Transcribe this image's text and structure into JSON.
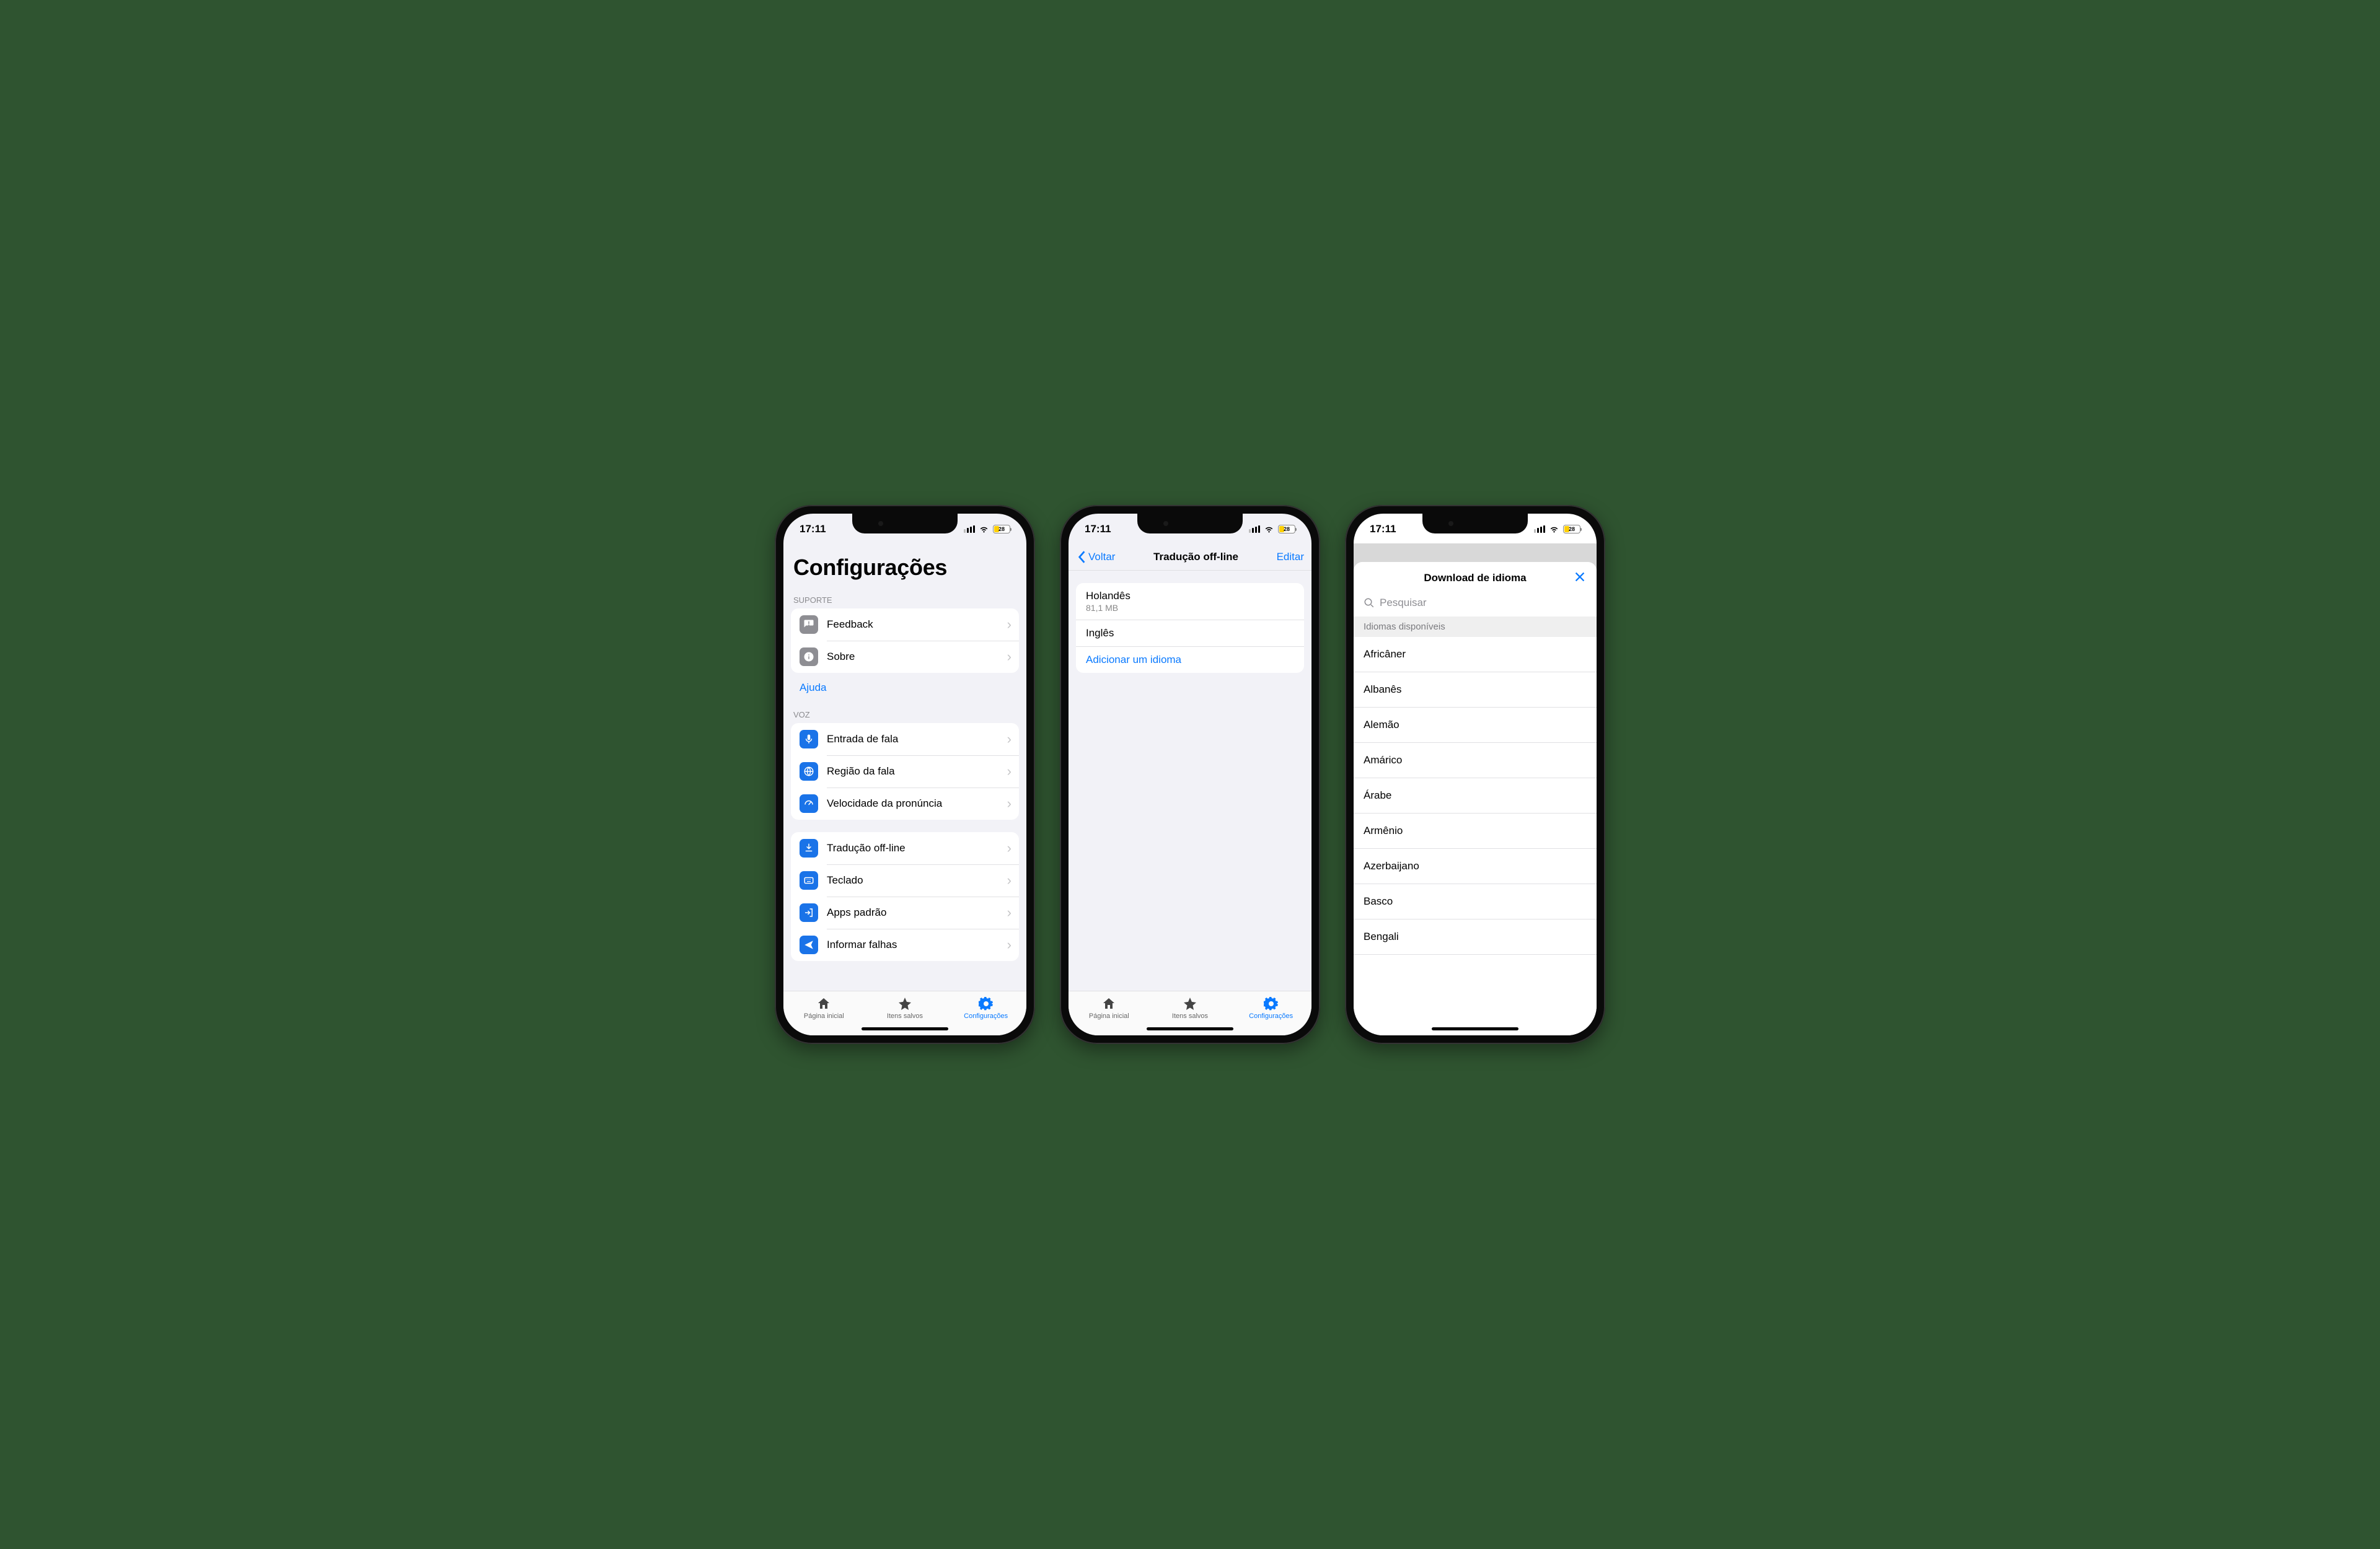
{
  "status": {
    "time": "17:11",
    "battery": "28"
  },
  "screen1": {
    "title": "Configurações",
    "sec_suporte": "SUPORTE",
    "feedback": "Feedback",
    "sobre": "Sobre",
    "ajuda": "Ajuda",
    "sec_voz": "VOZ",
    "entrada": "Entrada de fala",
    "regiao": "Região da fala",
    "velocidade": "Velocidade da pronúncia",
    "traducao": "Tradução off-line",
    "teclado": "Teclado",
    "apps": "Apps padrão",
    "informar": "Informar falhas"
  },
  "tabs": {
    "home": "Página inicial",
    "saved": "Itens salvos",
    "settings": "Configurações"
  },
  "screen2": {
    "back": "Voltar",
    "title": "Tradução off-line",
    "edit": "Editar",
    "lang1": "Holandês",
    "lang1_size": "81,1 MB",
    "lang2": "Inglês",
    "add": "Adicionar um idioma"
  },
  "screen3": {
    "title": "Download de idioma",
    "search_placeholder": "Pesquisar",
    "section": "Idiomas disponíveis",
    "langs": [
      "Africâner",
      "Albanês",
      "Alemão",
      "Amárico",
      "Árabe",
      "Armênio",
      "Azerbaijano",
      "Basco",
      "Bengali"
    ]
  }
}
